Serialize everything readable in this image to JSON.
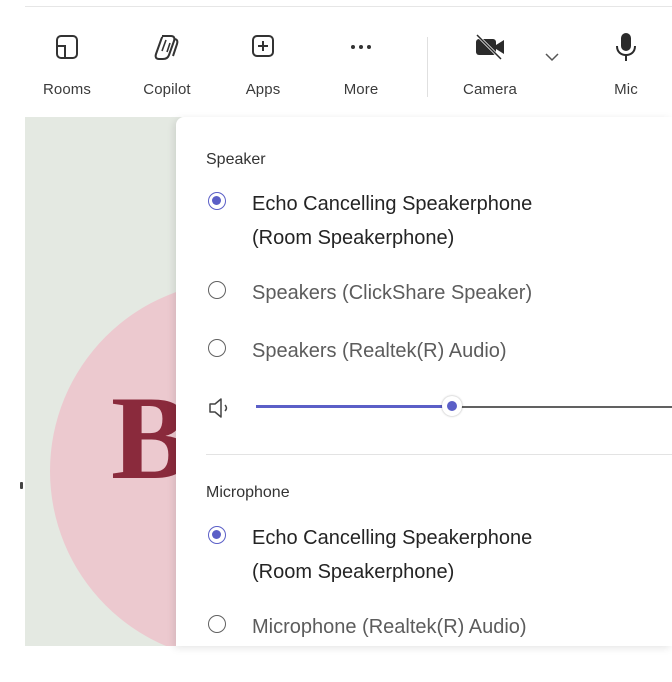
{
  "toolbar": {
    "items": [
      {
        "label": "Rooms",
        "icon": "rooms-icon"
      },
      {
        "label": "Copilot",
        "icon": "copilot-icon"
      },
      {
        "label": "Apps",
        "icon": "apps-add-icon"
      },
      {
        "label": "More",
        "icon": "more-ellipsis-icon"
      },
      {
        "label": "Camera",
        "icon": "camera-off-icon"
      },
      {
        "label": "Mic",
        "icon": "microphone-icon"
      }
    ],
    "camera_options_icon": "chevron-down-icon"
  },
  "avatar": {
    "initial": "B",
    "bg_color": "#ecc9cf",
    "letter_color": "#8a2a3c"
  },
  "panel": {
    "speaker": {
      "title": "Speaker",
      "options": [
        {
          "label_line1": "Echo Cancelling Speakerphone",
          "label_line2": "(Room Speakerphone)",
          "selected": true
        },
        {
          "label": "Speakers (ClickShare Speaker)",
          "selected": false
        },
        {
          "label": "Speakers (Realtek(R) Audio)",
          "selected": false
        }
      ],
      "volume": {
        "icon": "speaker-volume-icon",
        "level": 0.45
      }
    },
    "microphone": {
      "title": "Microphone",
      "options": [
        {
          "label_line1": "Echo Cancelling Speakerphone",
          "label_line2": "(Room Speakerphone)",
          "selected": true
        },
        {
          "label": "Microphone (Realtek(R) Audio)",
          "selected": false
        }
      ]
    }
  },
  "colors": {
    "accent": "#5b5fc7",
    "stage_bg": "#e4e9e2"
  }
}
